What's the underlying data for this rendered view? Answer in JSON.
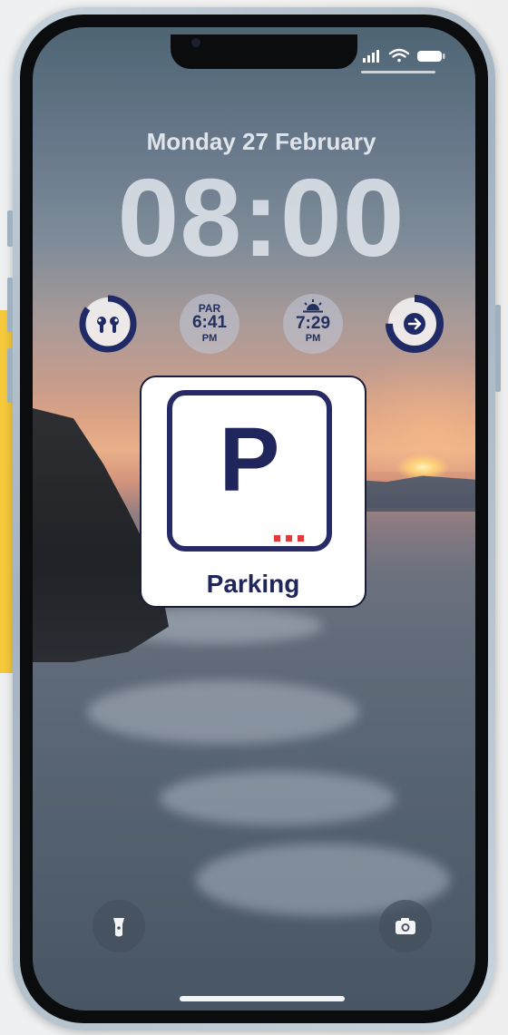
{
  "lockscreen": {
    "date": "Monday 27 February",
    "time": "08:00"
  },
  "widgets": [
    {
      "name": "airpods-battery",
      "icon": "airpods-icon",
      "progress": 0.85
    },
    {
      "name": "golf-par-time",
      "label": "PAR",
      "value": "6:41",
      "period": "PM"
    },
    {
      "name": "sunrise-time",
      "icon": "sunrise-icon",
      "value": "7:29",
      "period": "PM"
    },
    {
      "name": "directions",
      "icon": "arrow-right-icon",
      "progress": 0.75
    }
  ],
  "parking_card": {
    "letter": "P",
    "label": "Parking",
    "dots_color": "#e23a3a"
  },
  "colors": {
    "accent": "#1f2a66",
    "panel_yellow": "#f6c93b"
  },
  "bottom_controls": {
    "left_icon": "flashlight-icon",
    "right_icon": "camera-icon"
  }
}
